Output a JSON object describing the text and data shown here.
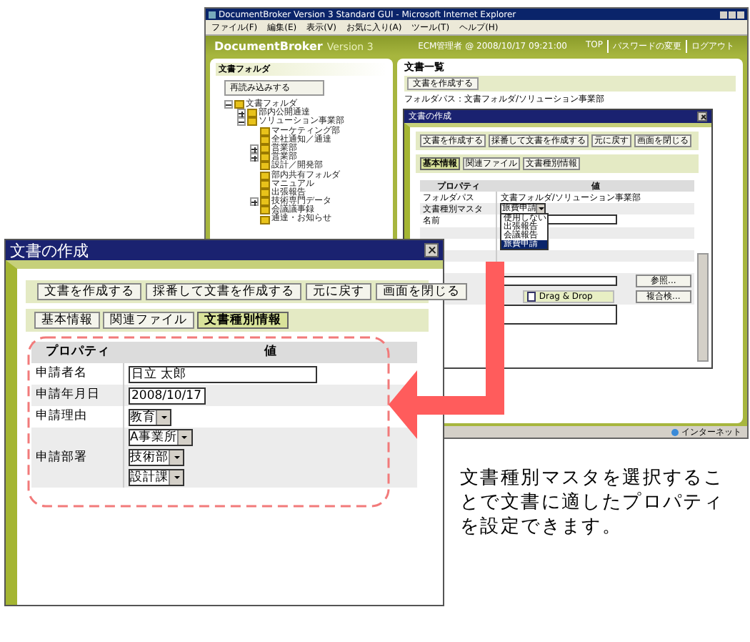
{
  "browser": {
    "title": "DocumentBroker Version 3 Standard GUI - Microsoft Internet Explorer",
    "menu": [
      "ファイル(F)",
      "編集(E)",
      "表示(V)",
      "お気に入り(A)",
      "ツール(T)",
      "ヘルプ(H)"
    ],
    "brand": {
      "name": "DocumentBroker",
      "version": "Version 3"
    },
    "user_info": "ECM管理者 @ 2008/10/17 09:21:00",
    "header_links": [
      "TOP",
      "パスワードの変更",
      "ログアウト"
    ],
    "sidebar": {
      "title": "文書フォルダ",
      "reload_button": "再読み込みする",
      "tree": [
        {
          "label": "文書フォルダ",
          "expanded": true,
          "children": [
            {
              "label": "部内公開通達",
              "expanded": false
            },
            {
              "label": "ソリューション事業部",
              "expanded": true,
              "children": [
                {
                  "label": "マーケティング部"
                },
                {
                  "label": "全社通知／通達"
                },
                {
                  "label": "営業部",
                  "expanded": false
                },
                {
                  "label": "営業部",
                  "expanded": false
                },
                {
                  "label": "設計／開発部"
                },
                {
                  "label": "部内共有フォルダ"
                },
                {
                  "label": "マニュアル"
                },
                {
                  "label": "出張報告"
                },
                {
                  "label": "技術専門データ",
                  "expanded": false
                },
                {
                  "label": "会議議事録"
                },
                {
                  "label": "通達・お知らせ"
                }
              ]
            }
          ]
        }
      ]
    },
    "main": {
      "title": "文書一覧",
      "create_button": "文書を作成する",
      "folder_path": "フォルダパス：文書フォルダ/ソリューション事業部"
    },
    "status_zone": "インターネット"
  },
  "back_dialog": {
    "title": "文書の作成",
    "buttons": [
      "文書を作成する",
      "採番して文書を作成する",
      "元に戻す",
      "画面を閉じる"
    ],
    "tabs": [
      {
        "label": "基本情報",
        "selected": true
      },
      {
        "label": "関連ファイル",
        "selected": false
      },
      {
        "label": "文書種別情報",
        "selected": false
      }
    ],
    "columns": [
      "プロパティ",
      "値"
    ],
    "rows": [
      {
        "kind": "text",
        "label": "フォルダパス",
        "value": "文書フォルダ/ソリューション事業部"
      },
      {
        "kind": "select",
        "label": "文書種別マスタ",
        "value": "旅費申請",
        "options": [
          {
            "label": "使用しない",
            "selected": false
          },
          {
            "label": "出張報告",
            "selected": false
          },
          {
            "label": "会議報告",
            "selected": false
          },
          {
            "label": "旅費申請",
            "selected": true
          }
        ]
      },
      {
        "kind": "input",
        "label": "名前"
      },
      {
        "kind": "blank"
      },
      {
        "kind": "blank"
      },
      {
        "kind": "blank"
      },
      {
        "kind": "blank"
      },
      {
        "kind": "file",
        "browse_button": "参照...",
        "drop_label": "Drag & Drop",
        "extra_button": "複合検..."
      },
      {
        "kind": "textarea"
      }
    ]
  },
  "front_dialog": {
    "title": "文書の作成",
    "buttons": [
      "文書を作成する",
      "採番して文書を作成する",
      "元に戻す",
      "画面を閉じる"
    ],
    "tabs": [
      {
        "label": "基本情報",
        "selected": false
      },
      {
        "label": "関連ファイル",
        "selected": false
      },
      {
        "label": "文書種別情報",
        "selected": true
      }
    ],
    "columns": [
      "プロパティ",
      "値"
    ],
    "rows": [
      {
        "kind": "input",
        "label": "申請者名",
        "value": "日立 太郎"
      },
      {
        "kind": "input",
        "label": "申請年月日",
        "value": "2008/10/17"
      },
      {
        "kind": "selects",
        "label": "申請理由",
        "values": [
          "教育"
        ]
      },
      {
        "kind": "selects",
        "label": "申請部署",
        "values": [
          "A事業所",
          "技術部",
          "設計課"
        ]
      }
    ]
  },
  "caption": "文書種別マスタを選択することで文書に適したプロパティを設定できます。"
}
